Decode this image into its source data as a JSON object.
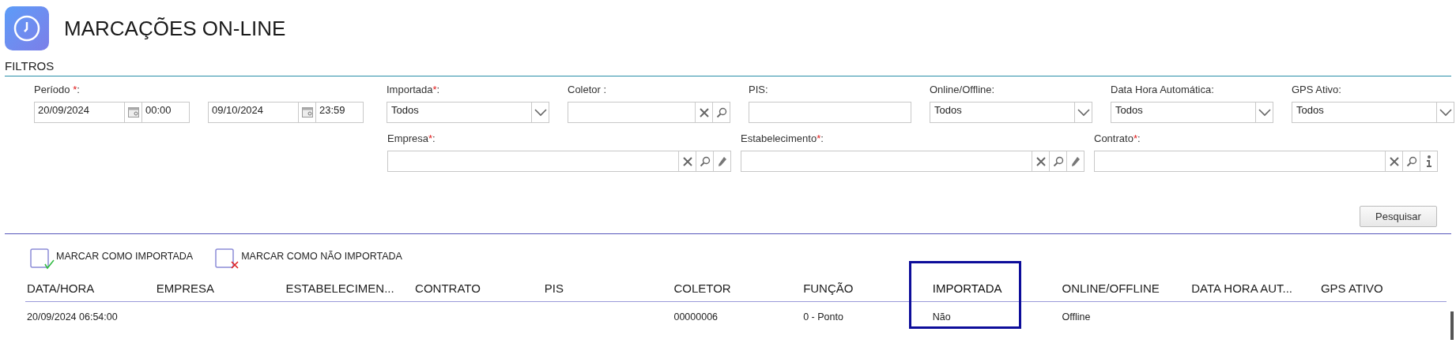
{
  "header": {
    "title": "MARCAÇÕES ON-LINE"
  },
  "filters": {
    "title": "FILTROS",
    "row_1": [
      {
        "kind": "period",
        "label": "Período ",
        "required_mark": "*",
        "suffix": ":",
        "ranges": [
          {
            "date": "20/09/2024",
            "time": "00:00"
          },
          {
            "date": "09/10/2024",
            "time": "23:59"
          }
        ]
      },
      {
        "kind": "select",
        "label": "Importada",
        "required_mark": "*",
        "suffix": ":",
        "value": "Todos"
      },
      {
        "kind": "lookup",
        "label": "Coletor :"
      },
      {
        "kind": "text",
        "label": "PIS:"
      },
      {
        "kind": "select",
        "label": "Online/Offline:",
        "value": "Todos"
      },
      {
        "kind": "select",
        "label": "Data Hora Automática:",
        "value": "Todos"
      },
      {
        "kind": "select",
        "label": "GPS Ativo:",
        "value": "Todos"
      }
    ],
    "row_2": [
      {
        "kind": "lookup-edit",
        "label": "Empresa",
        "required_mark": "*",
        "suffix": ":"
      },
      {
        "kind": "lookup-edit",
        "label": "Estabelecimento",
        "required_mark": "*",
        "suffix": ":"
      },
      {
        "kind": "lookup-info",
        "label": "Contrato",
        "required_mark": "*",
        "suffix": ":"
      }
    ],
    "search_button": "Pesquisar"
  },
  "actions": [
    {
      "kind": "mark",
      "label": "MARCAR COMO IMPORTADA"
    },
    {
      "kind": "unmark",
      "label": "MARCAR COMO NÃO IMPORTADA"
    }
  ],
  "table": {
    "columns": [
      {
        "label": "DATA/HORA",
        "highlighted": false
      },
      {
        "label": "EMPRESA",
        "highlighted": false
      },
      {
        "label": "ESTABELECIMEN...",
        "highlighted": false
      },
      {
        "label": "CONTRATO",
        "highlighted": false
      },
      {
        "label": "PIS",
        "highlighted": false
      },
      {
        "label": "COLETOR",
        "highlighted": false
      },
      {
        "label": "FUNÇÃO",
        "highlighted": false
      },
      {
        "label": "IMPORTADA",
        "highlighted": true
      },
      {
        "label": "ONLINE/OFFLINE",
        "highlighted": false
      },
      {
        "label": "DATA HORA AUT...",
        "highlighted": false
      },
      {
        "label": "GPS ATIVO",
        "highlighted": false
      }
    ],
    "rows": [
      [
        "20/09/2024 06:54:00",
        "",
        "",
        "",
        "",
        "00000006",
        "0 - Ponto",
        "Não",
        "Offline",
        "",
        ""
      ]
    ]
  }
}
